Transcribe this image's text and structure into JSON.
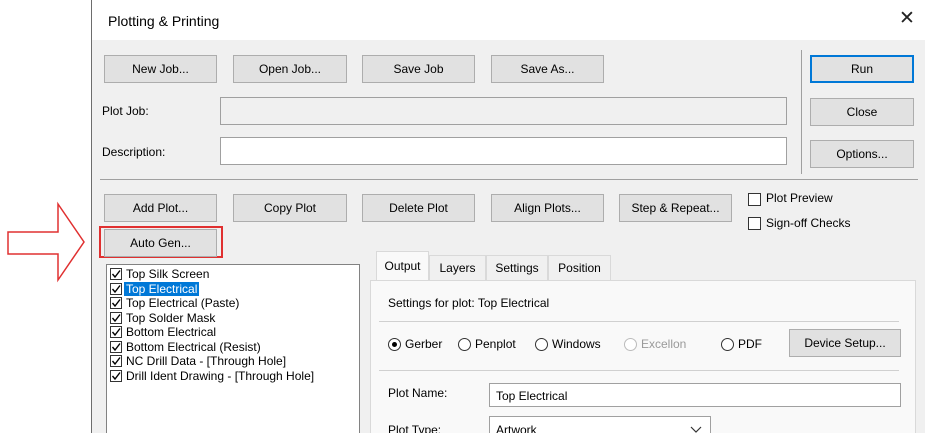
{
  "window": {
    "title": "Plotting & Printing",
    "close_glyph": "✕"
  },
  "job_buttons": {
    "new_job": "New Job...",
    "open_job": "Open Job...",
    "save_job": "Save Job",
    "save_as": "Save As..."
  },
  "side_buttons": {
    "run": "Run",
    "close": "Close",
    "options": "Options..."
  },
  "fields": {
    "plot_job_label": "Plot Job:",
    "plot_job_value": "",
    "description_label": "Description:",
    "description_value": ""
  },
  "plot_buttons": {
    "add_plot": "Add Plot...",
    "copy_plot": "Copy Plot",
    "delete_plot": "Delete Plot",
    "align_plots": "Align Plots...",
    "step_repeat": "Step & Repeat...",
    "auto_gen": "Auto Gen..."
  },
  "checks": {
    "plot_preview": "Plot Preview",
    "plot_preview_checked": false,
    "signoff": "Sign-off Checks",
    "signoff_checked": false
  },
  "plot_list": [
    {
      "label": "Top Silk Screen",
      "checked": true,
      "selected": false
    },
    {
      "label": "Top Electrical",
      "checked": true,
      "selected": true
    },
    {
      "label": "Top Electrical (Paste)",
      "checked": true,
      "selected": false
    },
    {
      "label": "Top Solder Mask",
      "checked": true,
      "selected": false
    },
    {
      "label": "Bottom Electrical",
      "checked": true,
      "selected": false
    },
    {
      "label": "Bottom Electrical (Resist)",
      "checked": true,
      "selected": false
    },
    {
      "label": "NC Drill Data - [Through Hole]",
      "checked": true,
      "selected": false
    },
    {
      "label": "Drill Ident Drawing - [Through Hole]",
      "checked": true,
      "selected": false
    }
  ],
  "tabs": [
    {
      "label": "Output",
      "active": true
    },
    {
      "label": "Layers",
      "active": false
    },
    {
      "label": "Settings",
      "active": false
    },
    {
      "label": "Position",
      "active": false
    }
  ],
  "output": {
    "settings_heading": "Settings for plot: Top Electrical",
    "radios": [
      {
        "label": "Gerber",
        "selected": true,
        "enabled": true
      },
      {
        "label": "Penplot",
        "selected": false,
        "enabled": true
      },
      {
        "label": "Windows",
        "selected": false,
        "enabled": true
      },
      {
        "label": "Excellon",
        "selected": false,
        "enabled": false
      },
      {
        "label": "PDF",
        "selected": false,
        "enabled": true
      }
    ],
    "device_setup": "Device Setup...",
    "plot_name_label": "Plot Name:",
    "plot_name_value": "Top Electrical",
    "plot_type_label": "Plot Type:",
    "plot_type_value": "Artwork"
  },
  "annotation": {
    "arrow_color": "#e03030",
    "highlight_color": "#e03030"
  }
}
